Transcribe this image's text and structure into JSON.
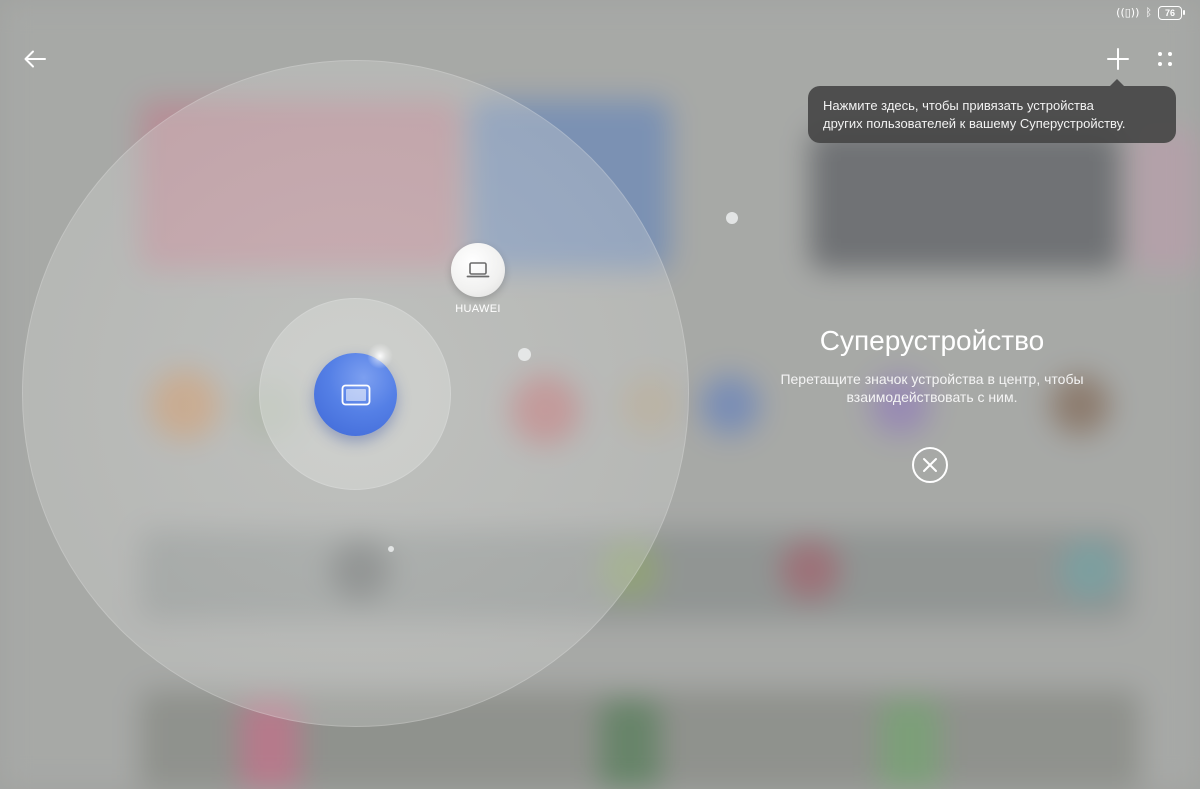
{
  "status_bar": {
    "vibrate_icon": "vibrate-icon",
    "bluetooth_icon": "bluetooth-icon",
    "battery_level": "76"
  },
  "header": {
    "back_icon": "back-arrow-icon",
    "add_icon": "plus-icon",
    "more_icon": "grid-dots-icon"
  },
  "tooltip": {
    "line1": "Нажмите здесь, чтобы привязать устройства",
    "line2": "других пользователей к вашему Суперустройству."
  },
  "radar": {
    "center_device_icon": "tablet-icon",
    "devices": [
      {
        "label": "HUAWEI",
        "icon": "laptop-icon"
      }
    ]
  },
  "info": {
    "title": "Суперустройство",
    "desc_line1": "Перетащите значок устройства в центр, чтобы",
    "desc_line2": "взаимодействовать с ним.",
    "close_icon": "close-icon"
  },
  "colors": {
    "accent_blue": "#4f78e2",
    "tooltip_bg": "#464746",
    "text_white": "#ffffff"
  }
}
